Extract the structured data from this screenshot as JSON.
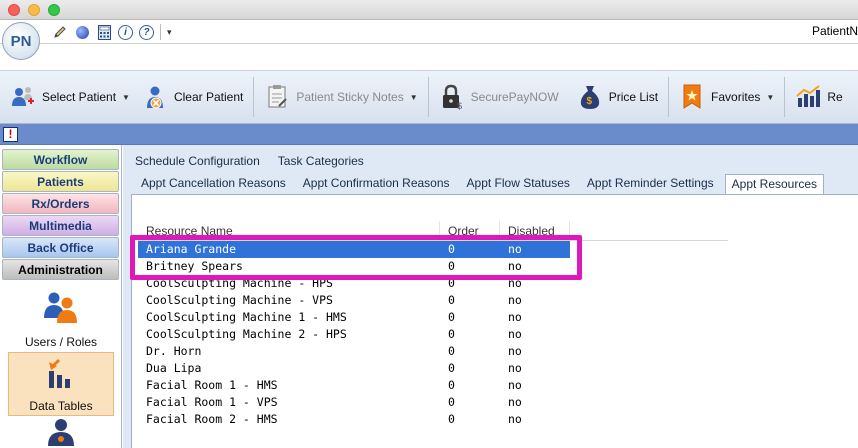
{
  "window": {
    "title": "PatientN"
  },
  "logo_text": "PN",
  "quickbar": {
    "icons": [
      "pencil-icon",
      "globe-icon",
      "calculator-icon",
      "info-icon",
      "help-icon"
    ],
    "customize_arrow": "▾"
  },
  "toolbar": {
    "select_patient": "Select Patient",
    "clear_patient": "Clear Patient",
    "sticky_notes": "Patient Sticky Notes",
    "securepay": "SecurePayNOW",
    "price_list": "Price List",
    "favorites": "Favorites",
    "reports": "Re"
  },
  "sidebar": {
    "nav": {
      "workflow": "Workflow",
      "patients": "Patients",
      "rx_orders": "Rx/Orders",
      "multimedia": "Multimedia",
      "back_office": "Back Office",
      "administration": "Administration"
    },
    "tiles": {
      "users_roles": "Users / Roles",
      "data_tables": "Data Tables"
    }
  },
  "tabs": {
    "row1": [
      "Schedule Configuration",
      "Task Categories"
    ],
    "row2": [
      "Appt Cancellation Reasons",
      "Appt Confirmation Reasons",
      "Appt Flow Statuses",
      "Appt Reminder Settings",
      "Appt Resources"
    ],
    "active": "Appt Resources"
  },
  "grid": {
    "headers": {
      "name": "Resource Name",
      "order": "Order",
      "disabled": "Disabled"
    },
    "rows": [
      {
        "name": "Ariana Grande",
        "order": "0",
        "disabled": "no",
        "selected": true
      },
      {
        "name": "Britney Spears",
        "order": "0",
        "disabled": "no"
      },
      {
        "name": "CoolSculpting Machine - HPS",
        "order": "0",
        "disabled": "no"
      },
      {
        "name": "CoolSculpting Machine - VPS",
        "order": "0",
        "disabled": "no"
      },
      {
        "name": "CoolSculpting Machine 1 - HMS",
        "order": "0",
        "disabled": "no"
      },
      {
        "name": "CoolSculpting Machine 2 - HPS",
        "order": "0",
        "disabled": "no"
      },
      {
        "name": "Dr. Horn",
        "order": "0",
        "disabled": "no"
      },
      {
        "name": "Dua Lipa",
        "order": "0",
        "disabled": "no"
      },
      {
        "name": "Facial Room 1 - HMS",
        "order": "0",
        "disabled": "no"
      },
      {
        "name": "Facial Room 1 - VPS",
        "order": "0",
        "disabled": "no"
      },
      {
        "name": "Facial Room 2 - HMS",
        "order": "0",
        "disabled": "no"
      }
    ]
  },
  "colors": {
    "selection": "#2f73d8",
    "highlight": "#e118b9",
    "alert_strip": "#6b8ccb"
  }
}
